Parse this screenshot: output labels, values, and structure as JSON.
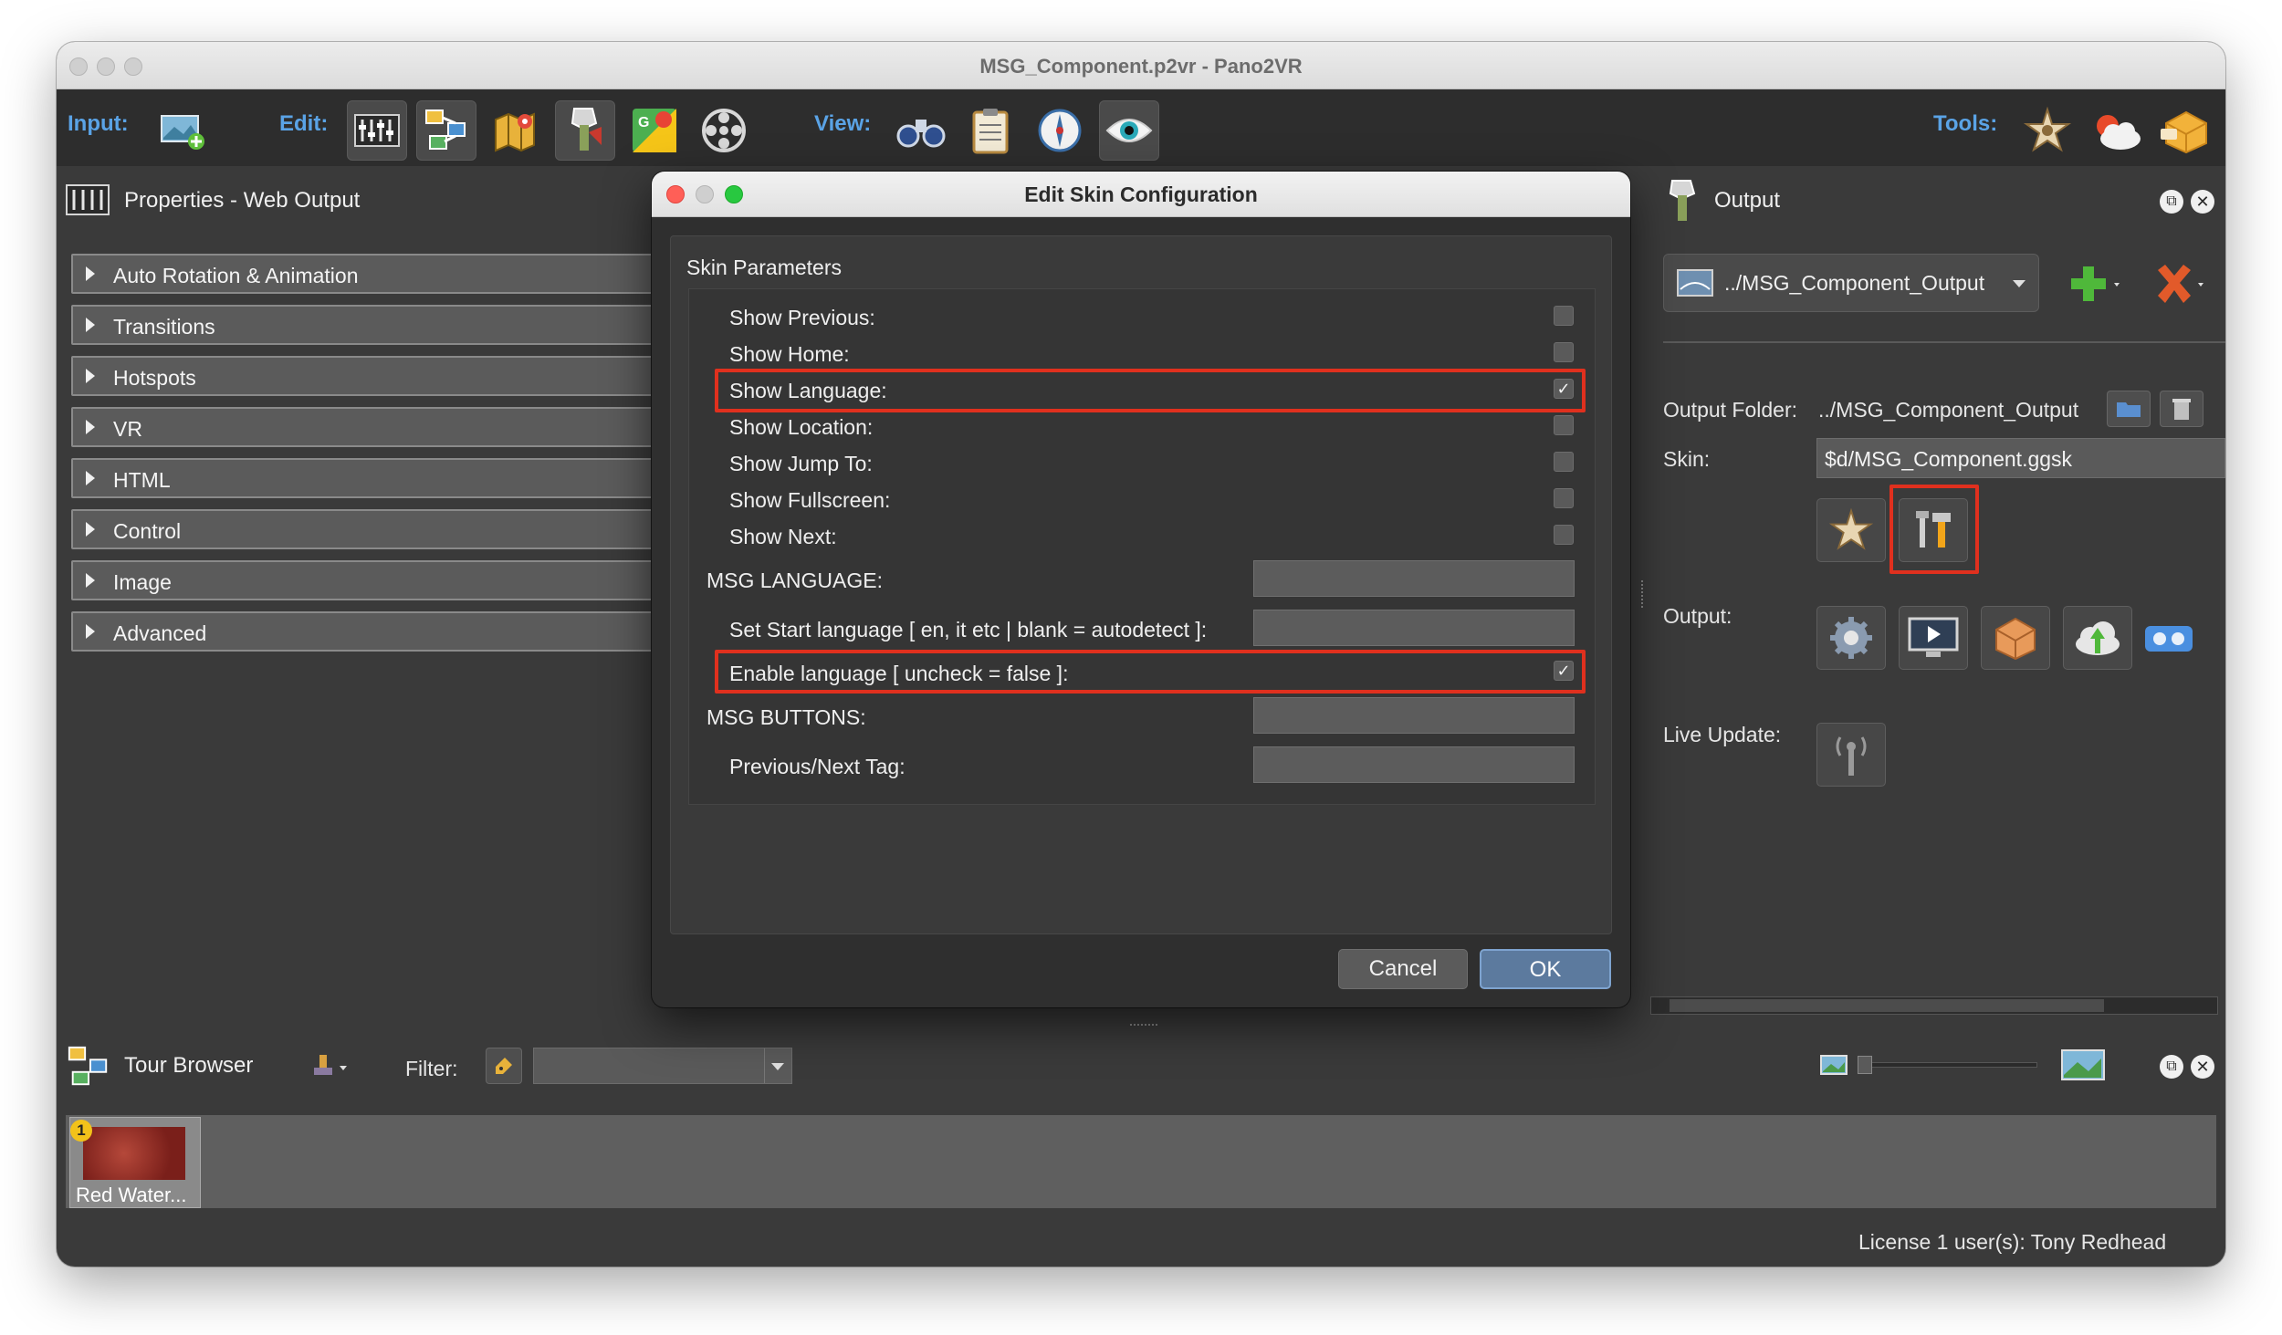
{
  "window": {
    "title": "MSG_Component.p2vr - Pano2VR"
  },
  "toolbar": {
    "input_label": "Input:",
    "edit_label": "Edit:",
    "view_label": "View:",
    "tools_label": "Tools:",
    "input_icons": [
      "image-add-icon"
    ],
    "edit_icons": [
      "properties-icon",
      "tour-browser-icon",
      "map-icon",
      "output-icon",
      "google-maps-icon",
      "film-reel-icon"
    ],
    "view_icons": [
      "binoculars-icon",
      "clipboard-icon",
      "compass-icon",
      "eye-icon"
    ],
    "tools_icons": [
      "skin-editor-icon",
      "cloud-icon",
      "package-icon"
    ]
  },
  "properties": {
    "title": "Properties - Web Output",
    "sections": [
      "Auto Rotation & Animation",
      "Transitions",
      "Hotspots",
      "VR",
      "HTML",
      "Control",
      "Image",
      "Advanced"
    ]
  },
  "dialog": {
    "title": "Edit Skin Configuration",
    "group_label": "Skin Parameters",
    "checkbox_rows": [
      {
        "label": "Show Previous:",
        "checked": false
      },
      {
        "label": "Show Home:",
        "checked": false
      },
      {
        "label": "Show Language:",
        "checked": true
      },
      {
        "label": "Show Location:",
        "checked": false
      },
      {
        "label": "Show Jump To:",
        "checked": false
      },
      {
        "label": "Show Fullscreen:",
        "checked": false
      },
      {
        "label": "Show Next:",
        "checked": false
      }
    ],
    "msg_language_label": "MSG LANGUAGE:",
    "start_language_label": "Set Start language [ en, it etc | blank = autodetect ]:",
    "enable_language_label": "Enable language [ uncheck = false ]:",
    "enable_language_checked": true,
    "msg_buttons_label": "MSG BUTTONS:",
    "prev_next_tag_label": "Previous/Next Tag:",
    "check_mark": "✓",
    "cancel_label": "Cancel",
    "ok_label": "OK"
  },
  "output": {
    "title": "Output",
    "selected_output": "../MSG_Component_Output",
    "folder_label": "Output Folder:",
    "folder_value": "../MSG_Component_Output",
    "skin_label": "Skin:",
    "skin_value": "$d/MSG_Component.ggsk",
    "output_label": "Output:",
    "live_update_label": "Live Update:"
  },
  "tour_browser": {
    "title": "Tour Browser",
    "filter_label": "Filter:",
    "thumbnail_label": "Red Water...",
    "thumbnail_badge": "1"
  },
  "status": {
    "license": "License 1 user(s): Tony Redhead"
  },
  "colors": {
    "highlight": "#e0301e",
    "accent_label": "#5aa3e6",
    "panel_bg": "#3a3a3a",
    "toolbar_bg": "#2d2d2d"
  }
}
